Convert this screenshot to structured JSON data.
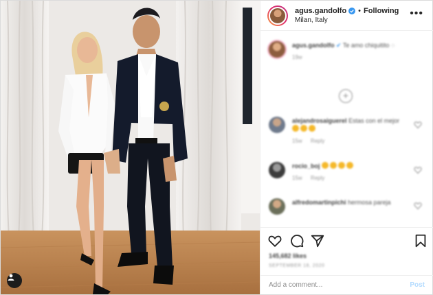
{
  "post": {
    "username": "agus.gandolfo",
    "verified": true,
    "follow_status": "Following",
    "separator": "•",
    "location": "Milan, Italy",
    "more_label": "•••",
    "tag_icon": "user-tag-icon",
    "accent_color": "#0095f6",
    "verified_color": "#3897f0"
  },
  "caption": {
    "username": "agus.gandolfo",
    "text": "Te amo chiquitito",
    "time": "19w"
  },
  "comments": [
    {
      "username": "alejandrosaiguerel",
      "text": "Estas con el mejor",
      "emoji_count": 3,
      "time": "15w",
      "reply_label": "Reply"
    },
    {
      "username": "rocio_boj",
      "text": "",
      "emoji_count": 4,
      "time": "15w",
      "reply_label": "Reply"
    },
    {
      "username": "alfredomartinpichi",
      "text": "hermosa pareja",
      "emoji_count": 0,
      "time": "",
      "reply_label": ""
    }
  ],
  "load_more_label": "+",
  "stats": {
    "likes": "145,682 likes",
    "date": "SEPTEMBER 18, 2020"
  },
  "composer": {
    "placeholder": "Add a comment...",
    "post_label": "Post"
  }
}
